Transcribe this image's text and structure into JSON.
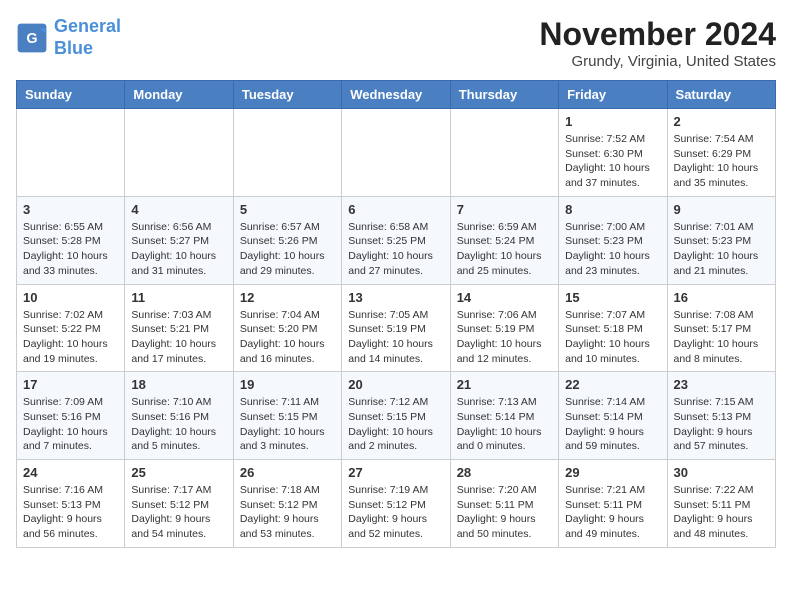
{
  "logo": {
    "line1": "General",
    "line2": "Blue"
  },
  "title": "November 2024",
  "location": "Grundy, Virginia, United States",
  "weekdays": [
    "Sunday",
    "Monday",
    "Tuesday",
    "Wednesday",
    "Thursday",
    "Friday",
    "Saturday"
  ],
  "weeks": [
    [
      {
        "day": "",
        "info": ""
      },
      {
        "day": "",
        "info": ""
      },
      {
        "day": "",
        "info": ""
      },
      {
        "day": "",
        "info": ""
      },
      {
        "day": "",
        "info": ""
      },
      {
        "day": "1",
        "info": "Sunrise: 7:52 AM\nSunset: 6:30 PM\nDaylight: 10 hours and 37 minutes."
      },
      {
        "day": "2",
        "info": "Sunrise: 7:54 AM\nSunset: 6:29 PM\nDaylight: 10 hours and 35 minutes."
      }
    ],
    [
      {
        "day": "3",
        "info": "Sunrise: 6:55 AM\nSunset: 5:28 PM\nDaylight: 10 hours and 33 minutes."
      },
      {
        "day": "4",
        "info": "Sunrise: 6:56 AM\nSunset: 5:27 PM\nDaylight: 10 hours and 31 minutes."
      },
      {
        "day": "5",
        "info": "Sunrise: 6:57 AM\nSunset: 5:26 PM\nDaylight: 10 hours and 29 minutes."
      },
      {
        "day": "6",
        "info": "Sunrise: 6:58 AM\nSunset: 5:25 PM\nDaylight: 10 hours and 27 minutes."
      },
      {
        "day": "7",
        "info": "Sunrise: 6:59 AM\nSunset: 5:24 PM\nDaylight: 10 hours and 25 minutes."
      },
      {
        "day": "8",
        "info": "Sunrise: 7:00 AM\nSunset: 5:23 PM\nDaylight: 10 hours and 23 minutes."
      },
      {
        "day": "9",
        "info": "Sunrise: 7:01 AM\nSunset: 5:23 PM\nDaylight: 10 hours and 21 minutes."
      }
    ],
    [
      {
        "day": "10",
        "info": "Sunrise: 7:02 AM\nSunset: 5:22 PM\nDaylight: 10 hours and 19 minutes."
      },
      {
        "day": "11",
        "info": "Sunrise: 7:03 AM\nSunset: 5:21 PM\nDaylight: 10 hours and 17 minutes."
      },
      {
        "day": "12",
        "info": "Sunrise: 7:04 AM\nSunset: 5:20 PM\nDaylight: 10 hours and 16 minutes."
      },
      {
        "day": "13",
        "info": "Sunrise: 7:05 AM\nSunset: 5:19 PM\nDaylight: 10 hours and 14 minutes."
      },
      {
        "day": "14",
        "info": "Sunrise: 7:06 AM\nSunset: 5:19 PM\nDaylight: 10 hours and 12 minutes."
      },
      {
        "day": "15",
        "info": "Sunrise: 7:07 AM\nSunset: 5:18 PM\nDaylight: 10 hours and 10 minutes."
      },
      {
        "day": "16",
        "info": "Sunrise: 7:08 AM\nSunset: 5:17 PM\nDaylight: 10 hours and 8 minutes."
      }
    ],
    [
      {
        "day": "17",
        "info": "Sunrise: 7:09 AM\nSunset: 5:16 PM\nDaylight: 10 hours and 7 minutes."
      },
      {
        "day": "18",
        "info": "Sunrise: 7:10 AM\nSunset: 5:16 PM\nDaylight: 10 hours and 5 minutes."
      },
      {
        "day": "19",
        "info": "Sunrise: 7:11 AM\nSunset: 5:15 PM\nDaylight: 10 hours and 3 minutes."
      },
      {
        "day": "20",
        "info": "Sunrise: 7:12 AM\nSunset: 5:15 PM\nDaylight: 10 hours and 2 minutes."
      },
      {
        "day": "21",
        "info": "Sunrise: 7:13 AM\nSunset: 5:14 PM\nDaylight: 10 hours and 0 minutes."
      },
      {
        "day": "22",
        "info": "Sunrise: 7:14 AM\nSunset: 5:14 PM\nDaylight: 9 hours and 59 minutes."
      },
      {
        "day": "23",
        "info": "Sunrise: 7:15 AM\nSunset: 5:13 PM\nDaylight: 9 hours and 57 minutes."
      }
    ],
    [
      {
        "day": "24",
        "info": "Sunrise: 7:16 AM\nSunset: 5:13 PM\nDaylight: 9 hours and 56 minutes."
      },
      {
        "day": "25",
        "info": "Sunrise: 7:17 AM\nSunset: 5:12 PM\nDaylight: 9 hours and 54 minutes."
      },
      {
        "day": "26",
        "info": "Sunrise: 7:18 AM\nSunset: 5:12 PM\nDaylight: 9 hours and 53 minutes."
      },
      {
        "day": "27",
        "info": "Sunrise: 7:19 AM\nSunset: 5:12 PM\nDaylight: 9 hours and 52 minutes."
      },
      {
        "day": "28",
        "info": "Sunrise: 7:20 AM\nSunset: 5:11 PM\nDaylight: 9 hours and 50 minutes."
      },
      {
        "day": "29",
        "info": "Sunrise: 7:21 AM\nSunset: 5:11 PM\nDaylight: 9 hours and 49 minutes."
      },
      {
        "day": "30",
        "info": "Sunrise: 7:22 AM\nSunset: 5:11 PM\nDaylight: 9 hours and 48 minutes."
      }
    ]
  ]
}
